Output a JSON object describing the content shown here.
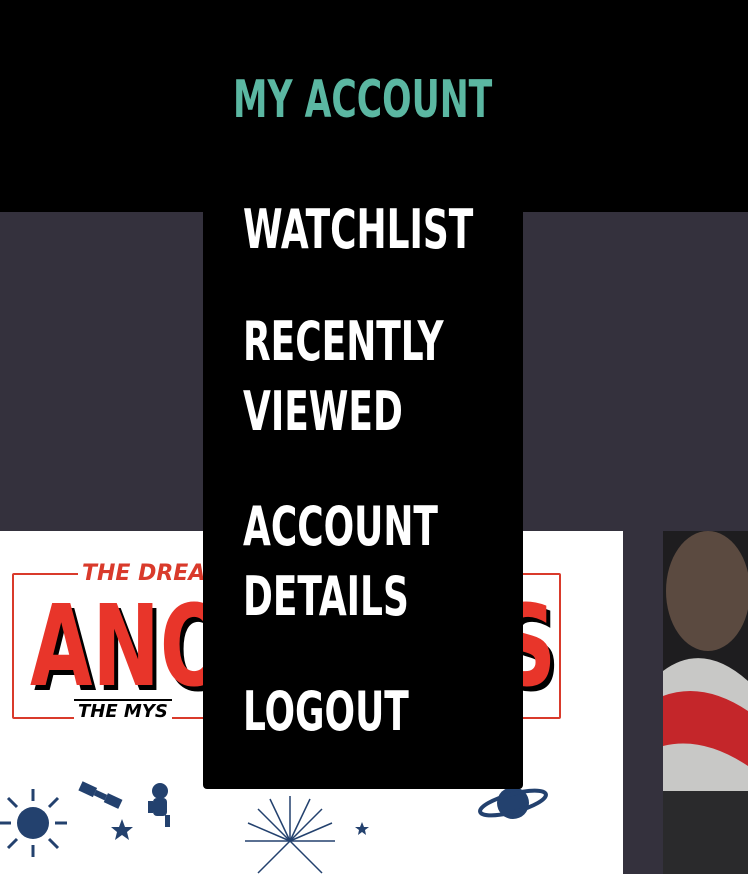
{
  "header": {
    "account_label": "MY ACCOUNT"
  },
  "dropdown": {
    "items": [
      {
        "lines": [
          "WATCHLIST"
        ]
      },
      {
        "lines": [
          "RECENTLY",
          "VIEWED"
        ]
      },
      {
        "lines": [
          "ACCOUNT",
          "DETAILS"
        ]
      },
      {
        "lines": [
          "LOGOUT"
        ]
      }
    ]
  },
  "background_card": {
    "logo_top_text": "THE DREA",
    "logo_big_text": "ANO",
    "logo_big_text_end": "S",
    "logo_sub_text": "THE MYS"
  },
  "colors": {
    "accent": "#5bb7a2",
    "header_bg": "#000000",
    "page_bg": "#34313d",
    "logo_red": "#e8352a",
    "icon_navy": "#23416e"
  }
}
